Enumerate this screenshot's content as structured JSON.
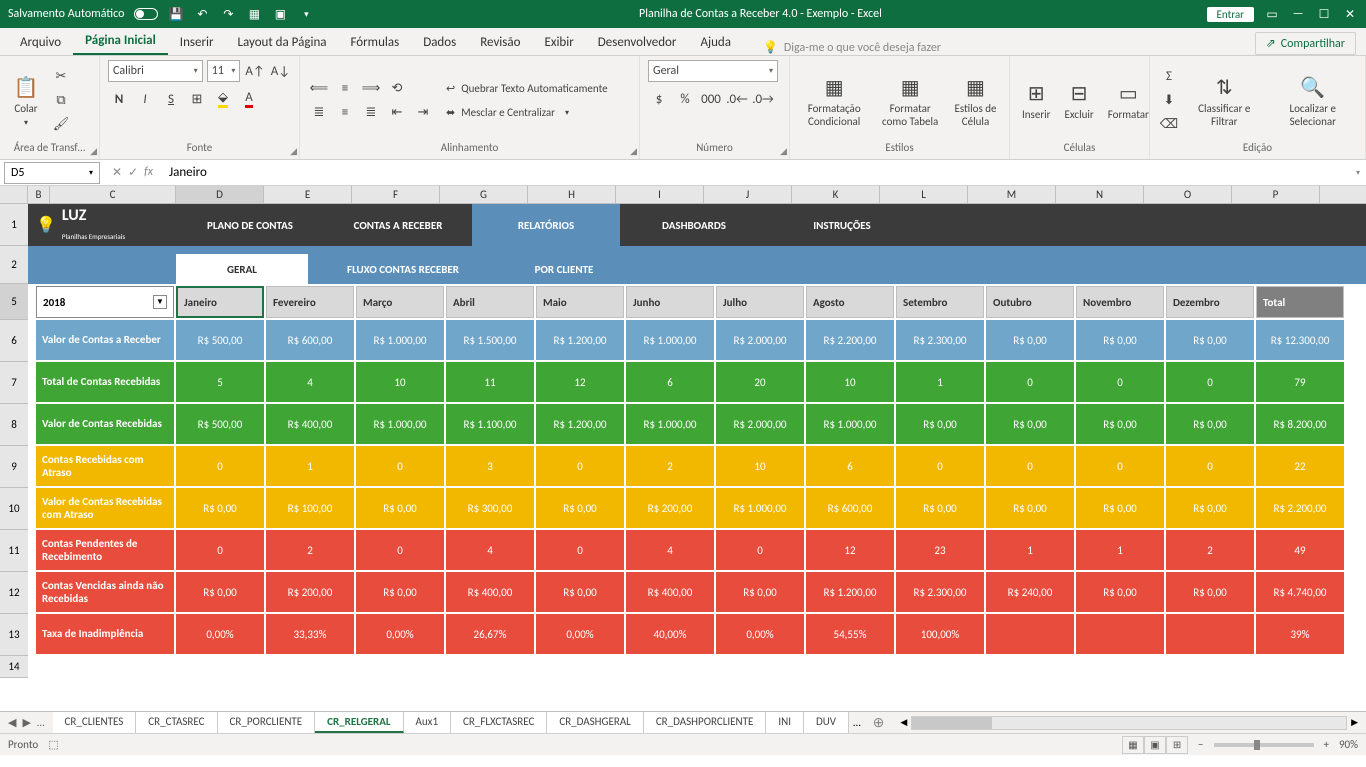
{
  "titlebar": {
    "autosave": "Salvamento Automático",
    "title": "Planilha de Contas a Receber 4.0 - Exemplo  -  Excel",
    "login": "Entrar"
  },
  "tabs": {
    "arquivo": "Arquivo",
    "pagina_inicial": "Página Inicial",
    "inserir": "Inserir",
    "layout": "Layout da Página",
    "formulas": "Fórmulas",
    "dados": "Dados",
    "revisao": "Revisão",
    "exibir": "Exibir",
    "desenvolvedor": "Desenvolvedor",
    "ajuda": "Ajuda",
    "tellme": "Diga-me o que você deseja fazer",
    "share": "Compartilhar"
  },
  "ribbon": {
    "clipboard": {
      "label": "Área de Transf…",
      "colar": "Colar"
    },
    "font": {
      "label": "Fonte",
      "name": "Calibri",
      "size": "11"
    },
    "align": {
      "label": "Alinhamento",
      "wrap": "Quebrar Texto Automaticamente",
      "merge": "Mesclar e Centralizar"
    },
    "number": {
      "label": "Número",
      "format": "Geral"
    },
    "styles": {
      "label": "Estilos",
      "cond": "Formatação Condicional",
      "table": "Formatar como Tabela",
      "cell": "Estilos de Célula"
    },
    "cells": {
      "label": "Células",
      "insert": "Inserir",
      "delete": "Excluir",
      "format": "Formatar"
    },
    "editing": {
      "label": "Edição",
      "sort": "Classificar e Filtrar",
      "find": "Localizar e Selecionar"
    }
  },
  "fbar": {
    "name": "D5",
    "formula": "Janeiro"
  },
  "cols": [
    "B",
    "C",
    "D",
    "E",
    "F",
    "G",
    "H",
    "I",
    "J",
    "K",
    "L",
    "M",
    "N",
    "O",
    "P"
  ],
  "rownums": [
    "1",
    "2",
    "5",
    "6",
    "7",
    "8",
    "9",
    "10",
    "11",
    "12",
    "13",
    "14"
  ],
  "nav": {
    "logo": "LUZ",
    "logo_sub": "Planilhas Empresariais",
    "items": [
      "PLANO DE CONTAS",
      "CONTAS A RECEBER",
      "RELATÓRIOS",
      "DASHBOARDS",
      "INSTRUÇÕES"
    ]
  },
  "subnav": [
    "GERAL",
    "FLUXO CONTAS RECEBER",
    "POR CLIENTE"
  ],
  "year": "2018",
  "months": [
    "Janeiro",
    "Fevereiro",
    "Março",
    "Abril",
    "Maio",
    "Junho",
    "Julho",
    "Agosto",
    "Setembro",
    "Outubro",
    "Novembro",
    "Dezembro",
    "Total"
  ],
  "rows": [
    {
      "color": "blue",
      "label": "Valor de Contas a Receber",
      "vals": [
        "R$ 500,00",
        "R$ 600,00",
        "R$ 1.000,00",
        "R$ 1.500,00",
        "R$ 1.200,00",
        "R$ 1.000,00",
        "R$ 2.000,00",
        "R$ 2.200,00",
        "R$ 2.300,00",
        "R$ 0,00",
        "R$ 0,00",
        "R$ 0,00",
        "R$ 12.300,00"
      ]
    },
    {
      "color": "green",
      "label": "Total de Contas Recebidas",
      "vals": [
        "5",
        "4",
        "10",
        "11",
        "12",
        "6",
        "20",
        "10",
        "1",
        "0",
        "0",
        "0",
        "79"
      ]
    },
    {
      "color": "green",
      "label": "Valor de Contas Recebidas",
      "vals": [
        "R$ 500,00",
        "R$ 400,00",
        "R$ 1.000,00",
        "R$ 1.100,00",
        "R$ 1.200,00",
        "R$ 1.000,00",
        "R$ 2.000,00",
        "R$ 1.000,00",
        "R$ 0,00",
        "R$ 0,00",
        "R$ 0,00",
        "R$ 0,00",
        "R$ 8.200,00"
      ]
    },
    {
      "color": "yellow",
      "label": "Contas Recebidas com Atraso",
      "vals": [
        "0",
        "1",
        "0",
        "3",
        "0",
        "2",
        "10",
        "6",
        "0",
        "0",
        "0",
        "0",
        "22"
      ]
    },
    {
      "color": "yellow",
      "label": "Valor de Contas Recebidas com Atraso",
      "vals": [
        "R$ 0,00",
        "R$ 100,00",
        "R$ 0,00",
        "R$ 300,00",
        "R$ 0,00",
        "R$ 200,00",
        "R$ 1.000,00",
        "R$ 600,00",
        "R$ 0,00",
        "R$ 0,00",
        "R$ 0,00",
        "R$ 0,00",
        "R$ 2.200,00"
      ]
    },
    {
      "color": "red",
      "label": "Contas Pendentes de Recebimento",
      "vals": [
        "0",
        "2",
        "0",
        "4",
        "0",
        "4",
        "0",
        "12",
        "23",
        "1",
        "1",
        "2",
        "49"
      ]
    },
    {
      "color": "red",
      "label": "Contas Vencidas ainda não Recebidas",
      "vals": [
        "R$ 0,00",
        "R$ 200,00",
        "R$ 0,00",
        "R$ 400,00",
        "R$ 0,00",
        "R$ 400,00",
        "R$ 0,00",
        "R$ 1.200,00",
        "R$ 2.300,00",
        "R$ 240,00",
        "R$ 0,00",
        "R$ 0,00",
        "R$ 4.740,00"
      ]
    },
    {
      "color": "red",
      "label": "Taxa de Inadimplência",
      "vals": [
        "0,00%",
        "33,33%",
        "0,00%",
        "26,67%",
        "0,00%",
        "40,00%",
        "0,00%",
        "54,55%",
        "100,00%",
        "",
        "",
        "",
        "39%"
      ]
    }
  ],
  "sheets": [
    "CR_CLIENTES",
    "CR_CTASREC",
    "CR_PORCLIENTE",
    "CR_RELGERAL",
    "Aux1",
    "CR_FLXCTASREC",
    "CR_DASHGERAL",
    "CR_DASHPORCLIENTE",
    "INI",
    "DUV"
  ],
  "active_sheet": "CR_RELGERAL",
  "status": {
    "ready": "Pronto",
    "zoom": "90%"
  }
}
